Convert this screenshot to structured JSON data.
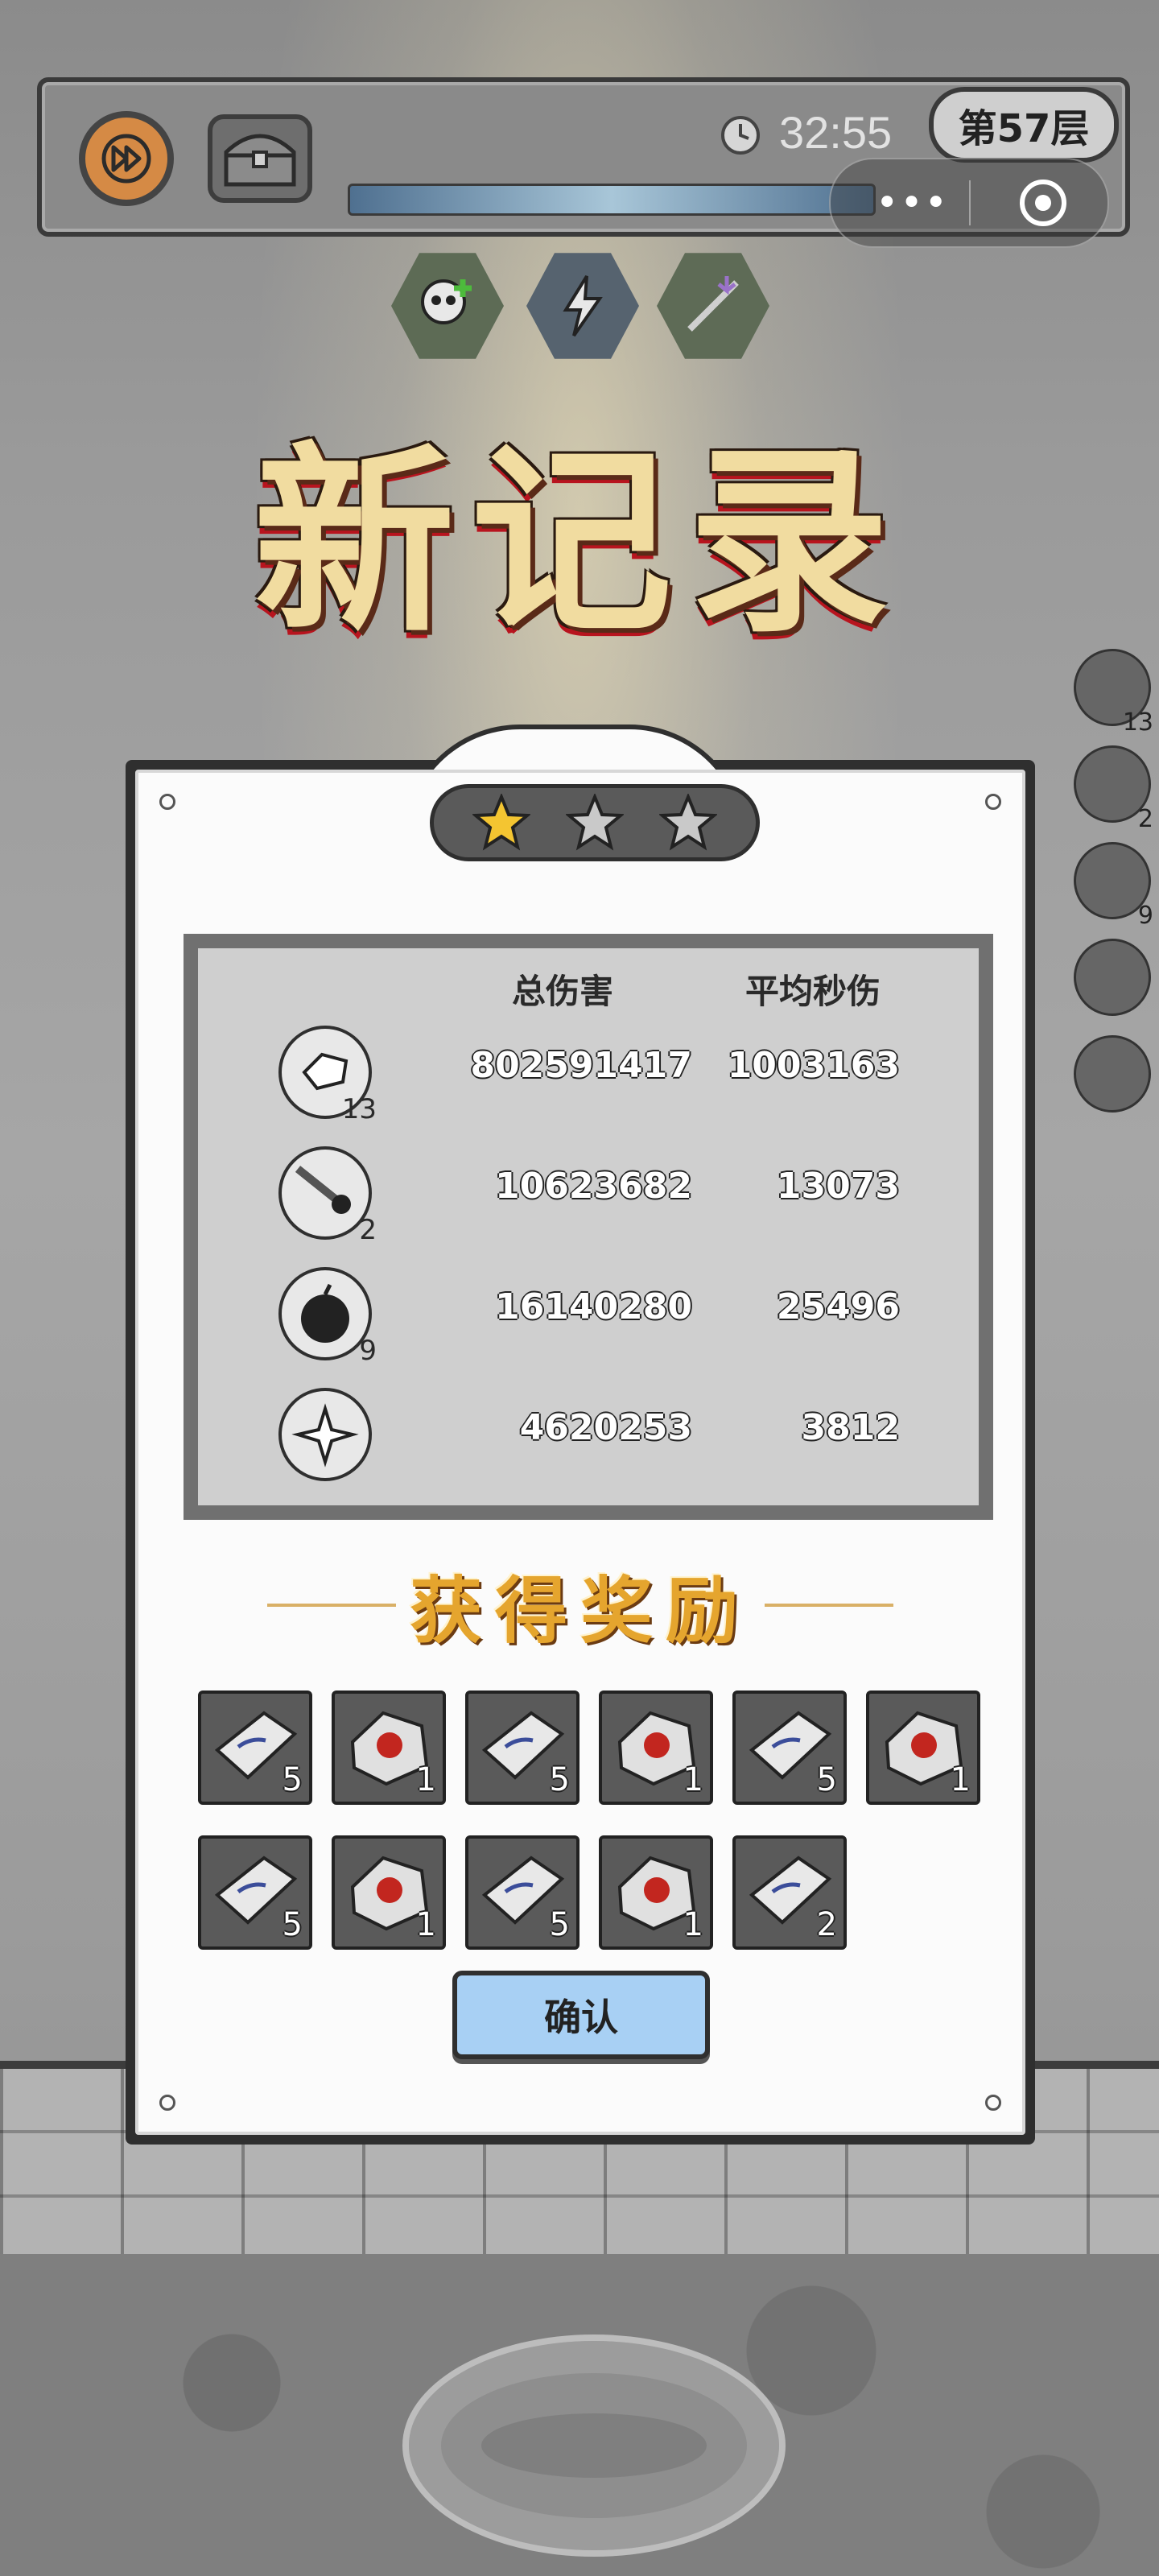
{
  "hud": {
    "timer": "32:55",
    "floor_label": "第57层"
  },
  "capsule": {
    "more_glyph": "•••"
  },
  "title": "新记录",
  "stars": {
    "earned": 1,
    "total": 3
  },
  "stats": {
    "headers": {
      "total_damage": "总伤害",
      "avg_dps": "平均秒伤"
    },
    "rows": [
      {
        "weapon": "crystal-shard-icon",
        "level": "13",
        "total_damage": "802591417",
        "avg_dps": "1003163"
      },
      {
        "weapon": "meteor-icon",
        "level": "2",
        "total_damage": "10623682",
        "avg_dps": "13073"
      },
      {
        "weapon": "bomb-icon",
        "level": "9",
        "total_damage": "16140280",
        "avg_dps": "25496"
      },
      {
        "weapon": "ice-burst-icon",
        "level": "",
        "total_damage": "4620253",
        "avg_dps": "3812"
      }
    ]
  },
  "side_icons": [
    {
      "icon": "crystal-shard-icon",
      "count": "13"
    },
    {
      "icon": "meteor-icon",
      "count": "2"
    },
    {
      "icon": "bomb-icon",
      "count": "9"
    },
    {
      "icon": "ice-burst-icon",
      "count": ""
    },
    {
      "icon": "empty-slot-icon",
      "count": ""
    }
  ],
  "rewards_title": "获得奖励",
  "rewards": [
    {
      "item": "silver-ingot-icon",
      "qty": "5"
    },
    {
      "item": "fire-ore-icon",
      "qty": "1"
    },
    {
      "item": "silver-ingot-icon",
      "qty": "5"
    },
    {
      "item": "fire-ore-icon",
      "qty": "1"
    },
    {
      "item": "silver-ingot-icon",
      "qty": "5"
    },
    {
      "item": "fire-ore-icon",
      "qty": "1"
    },
    {
      "item": "silver-ingot-icon",
      "qty": "5"
    },
    {
      "item": "fire-ore-icon",
      "qty": "1"
    },
    {
      "item": "silver-ingot-icon",
      "qty": "5"
    },
    {
      "item": "fire-ore-icon",
      "qty": "1"
    },
    {
      "item": "silver-ingot-icon",
      "qty": "2"
    }
  ],
  "confirm_label": "确认",
  "colors": {
    "title_gold": "#f1dca0",
    "title_red": "#b8141e",
    "reward_gold": "#e5a52e",
    "confirm_blue": "#a8d0f4",
    "star_gold": "#f4c531"
  }
}
